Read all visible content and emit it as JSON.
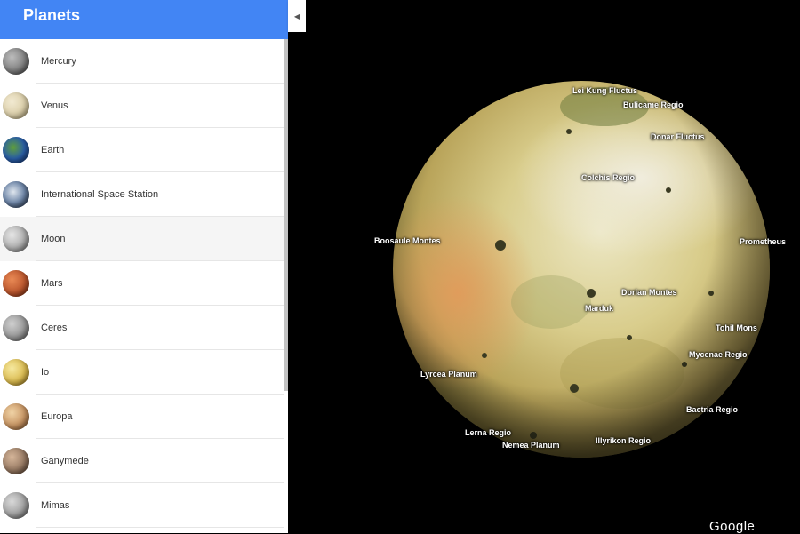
{
  "sidebar": {
    "title": "Planets",
    "items": [
      {
        "label": "Mercury",
        "thumb": "radial-gradient(circle at 35% 35%, #bdbdbd, #7a7a7a 60%, #3e3e3e)"
      },
      {
        "label": "Venus",
        "thumb": "radial-gradient(circle at 35% 35%, #f2ead2, #d9cca6 60%, #a99a70)"
      },
      {
        "label": "Earth",
        "thumb": "radial-gradient(circle at 40% 40%, #5f9e3a, #2a5fa8 50%, #14306a)"
      },
      {
        "label": "International Space Station",
        "thumb": "radial-gradient(circle at 40% 40%, #dfe6ee, #6e86a8 50%, #1d2a3f)"
      },
      {
        "label": "Moon",
        "thumb": "radial-gradient(circle at 35% 35%, #e6e6e6, #a8a8a8 60%, #6a6a6a)"
      },
      {
        "label": "Mars",
        "thumb": "radial-gradient(circle at 35% 35%, #e98a55, #b8522a 60%, #6e2a12)"
      },
      {
        "label": "Ceres",
        "thumb": "radial-gradient(circle at 35% 35%, #cfcfcf, #929292 60%, #555)"
      },
      {
        "label": "Io",
        "thumb": "radial-gradient(circle at 35% 35%, #f6e9a0, #d9b84a 60%, #8a6a1e)"
      },
      {
        "label": "Europa",
        "thumb": "radial-gradient(circle at 35% 35%, #f0d3a6, #c38e5c 60%, #7a5230)"
      },
      {
        "label": "Ganymede",
        "thumb": "radial-gradient(circle at 35% 35%, #d6b69a, #8f725c 60%, #4e3b2c)"
      },
      {
        "label": "Mimas",
        "thumb": "radial-gradient(circle at 35% 35%, #d9d9d9, #9a9a9a 60%, #5a5a5a)"
      }
    ],
    "hovered_index": 4
  },
  "map": {
    "collapse_glyph": "◀",
    "logo": "Google",
    "features": [
      {
        "name": "Lei Kung Fluctus"
      },
      {
        "name": "Bulicame Regio"
      },
      {
        "name": "Donar Fluctus"
      },
      {
        "name": "Colchis Regio"
      },
      {
        "name": "Boosaule Montes"
      },
      {
        "name": "Prometheus"
      },
      {
        "name": "Dorian Montes"
      },
      {
        "name": "Marduk"
      },
      {
        "name": "Tohil Mons"
      },
      {
        "name": "Mycenae Regio"
      },
      {
        "name": "Lyrcea Planum"
      },
      {
        "name": "Bactria Regio"
      },
      {
        "name": "Lerna Regio"
      },
      {
        "name": "Nemea Planum"
      },
      {
        "name": "Illyrikon Regio"
      }
    ]
  },
  "colors": {
    "header": "#4285f4",
    "space": "#000000"
  }
}
